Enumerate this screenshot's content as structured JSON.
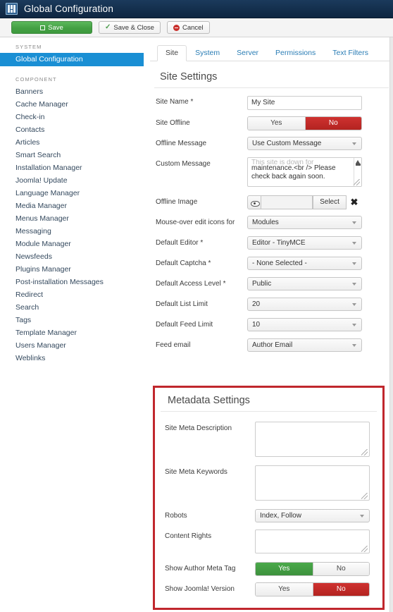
{
  "header": {
    "title": "Global Configuration",
    "icon": "grid-icon"
  },
  "toolbar": {
    "save_label": "Save",
    "save_close_label": "Save & Close",
    "cancel_label": "Cancel"
  },
  "sidebar": {
    "system_heading": "SYSTEM",
    "component_heading": "COMPONENT",
    "system_items": [
      {
        "label": "Global Configuration",
        "active": true
      }
    ],
    "component_items": [
      {
        "label": "Banners"
      },
      {
        "label": "Cache Manager"
      },
      {
        "label": "Check-in"
      },
      {
        "label": "Contacts"
      },
      {
        "label": "Articles"
      },
      {
        "label": "Smart Search"
      },
      {
        "label": "Installation Manager"
      },
      {
        "label": "Joomla! Update"
      },
      {
        "label": "Language Manager"
      },
      {
        "label": "Media Manager"
      },
      {
        "label": "Menus Manager"
      },
      {
        "label": "Messaging"
      },
      {
        "label": "Module Manager"
      },
      {
        "label": "Newsfeeds"
      },
      {
        "label": "Plugins Manager"
      },
      {
        "label": "Post-installation Messages"
      },
      {
        "label": "Redirect"
      },
      {
        "label": "Search"
      },
      {
        "label": "Tags"
      },
      {
        "label": "Template Manager"
      },
      {
        "label": "Users Manager"
      },
      {
        "label": "Weblinks"
      }
    ]
  },
  "tabs": [
    {
      "label": "Site",
      "active": true
    },
    {
      "label": "System",
      "active": false
    },
    {
      "label": "Server",
      "active": false
    },
    {
      "label": "Permissions",
      "active": false
    },
    {
      "label": "Text Filters",
      "active": false
    }
  ],
  "site_settings": {
    "title": "Site Settings",
    "fields": {
      "site_name": {
        "label": "Site Name *",
        "value": "My Site"
      },
      "site_offline": {
        "label": "Site Offline",
        "yes": "Yes",
        "no": "No",
        "selected": "No"
      },
      "offline_message": {
        "label": "Offline Message",
        "value": "Use Custom Message"
      },
      "custom_message": {
        "label": "Custom Message",
        "clipped_line": "This site is down for",
        "value": "maintenance.<br /> Please check back again soon."
      },
      "offline_image": {
        "label": "Offline Image",
        "value": "",
        "select_label": "Select",
        "clear_label": "✖"
      },
      "mouse_over_edit_icons": {
        "label": "Mouse-over edit icons for",
        "value": "Modules"
      },
      "default_editor": {
        "label": "Default Editor *",
        "value": "Editor - TinyMCE"
      },
      "default_captcha": {
        "label": "Default Captcha *",
        "value": "- None Selected -"
      },
      "default_access_level": {
        "label": "Default Access Level *",
        "value": "Public"
      },
      "default_list_limit": {
        "label": "Default List Limit",
        "value": "20"
      },
      "default_feed_limit": {
        "label": "Default Feed Limit",
        "value": "10"
      },
      "feed_email": {
        "label": "Feed email",
        "value": "Author Email"
      }
    }
  },
  "metadata_settings": {
    "title": "Metadata Settings",
    "highlight_color": "#c0272d",
    "fields": {
      "site_meta_description": {
        "label": "Site Meta Description",
        "value": ""
      },
      "site_meta_keywords": {
        "label": "Site Meta Keywords",
        "value": ""
      },
      "robots": {
        "label": "Robots",
        "value": "Index, Follow"
      },
      "content_rights": {
        "label": "Content Rights",
        "value": ""
      },
      "show_author_meta_tag": {
        "label": "Show Author Meta Tag",
        "yes": "Yes",
        "no": "No",
        "selected": "Yes"
      },
      "show_joomla_version": {
        "label": "Show Joomla! Version",
        "yes": "Yes",
        "no": "No",
        "selected": "No"
      }
    }
  },
  "colors": {
    "header_bg": "#15314f",
    "active_nav": "#1a8fd4",
    "save_green": "#44a044",
    "toggle_red": "#b32320",
    "toggle_green": "#3d913d",
    "link_blue": "#2a7db5"
  }
}
